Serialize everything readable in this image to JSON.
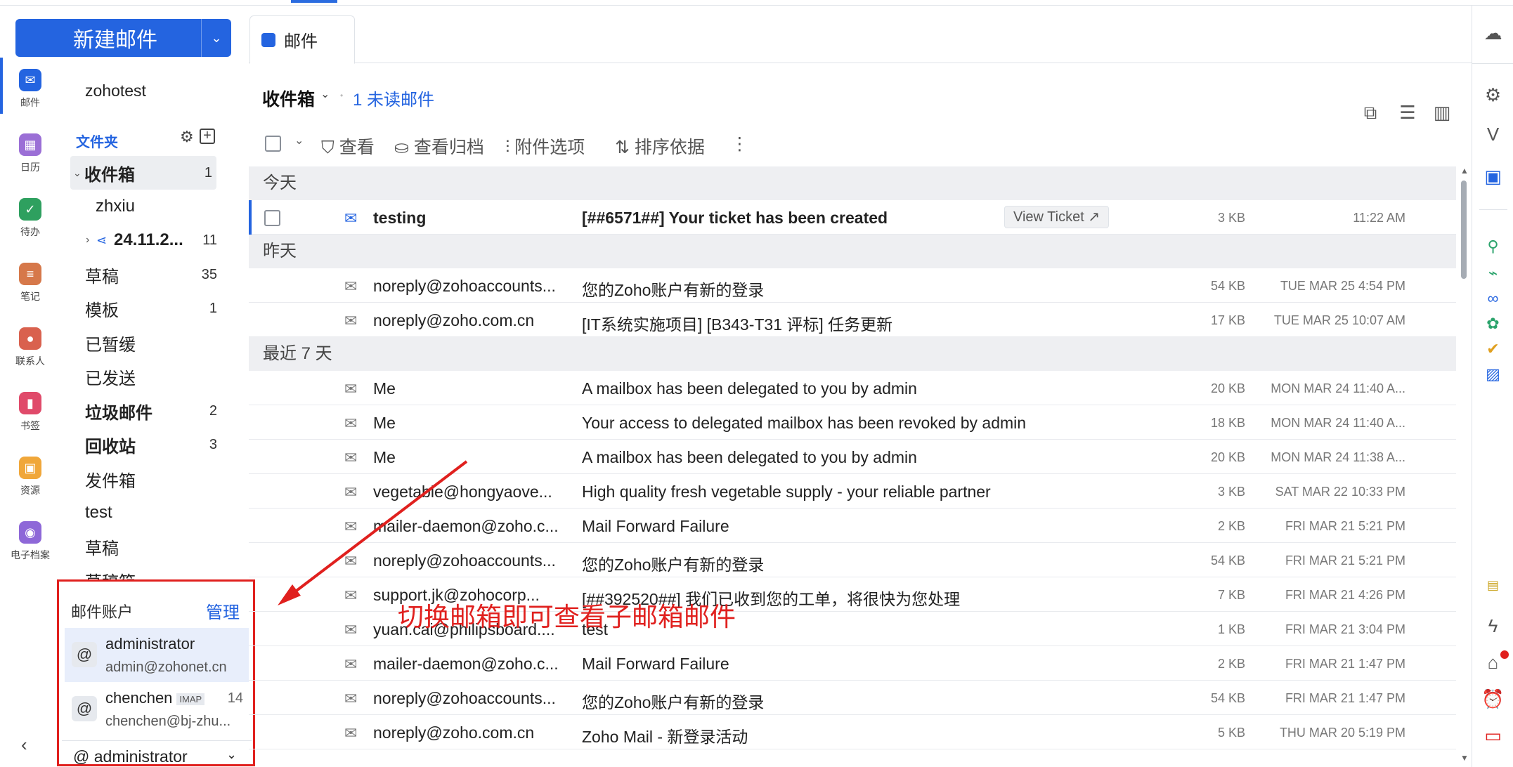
{
  "new_mail": {
    "label": "新建邮件"
  },
  "rail": [
    {
      "label": "邮件",
      "icon": "mail-icon",
      "color": "#2464e0"
    },
    {
      "label": "日历",
      "icon": "calendar-icon",
      "color": "#9b6fd6"
    },
    {
      "label": "待办",
      "icon": "check-icon",
      "color": "#2ea05f"
    },
    {
      "label": "笔记",
      "icon": "note-icon",
      "color": "#d6784a"
    },
    {
      "label": "联系人",
      "icon": "contact-icon",
      "color": "#d9614e"
    },
    {
      "label": "书签",
      "icon": "bookmark-icon",
      "color": "#e04a6a"
    },
    {
      "label": "资源",
      "icon": "resource-icon",
      "color": "#f0a73a"
    },
    {
      "label": "电子档案",
      "icon": "archive-icon",
      "color": "#8e68d8"
    }
  ],
  "folder_pane": {
    "account": "zohotest",
    "folders_label": "文件夹",
    "folders": [
      {
        "name": "收件箱",
        "count": "1"
      },
      {
        "name": "zhxiu",
        "count": ""
      },
      {
        "name": "24.11.2...",
        "count": "11"
      },
      {
        "name": "草稿",
        "count": "35"
      },
      {
        "name": "模板",
        "count": "1"
      },
      {
        "name": "已暂缓",
        "count": ""
      },
      {
        "name": "已发送",
        "count": ""
      },
      {
        "name": "垃圾邮件",
        "count": "2"
      },
      {
        "name": "回收站",
        "count": "3"
      },
      {
        "name": "发件箱",
        "count": ""
      },
      {
        "name": "test",
        "count": ""
      },
      {
        "name": "草稿",
        "count": ""
      },
      {
        "name": "草稿箱",
        "count": ""
      }
    ]
  },
  "accounts": {
    "title": "邮件账户",
    "manage": "管理",
    "items": [
      {
        "name": "administrator",
        "email": "admin@zohonet.cn",
        "tag": "",
        "count": ""
      },
      {
        "name": "chenchen",
        "email": "chenchen@bj-zhu...",
        "tag": "IMAP",
        "count": "14"
      }
    ],
    "selected": "administrator"
  },
  "tab": {
    "label": "邮件"
  },
  "mail_header": {
    "folder": "收件箱",
    "unread": "1 未读邮件"
  },
  "toolbar": {
    "view": "查看",
    "archive": "查看归档",
    "attachments": "附件选项",
    "sort": "排序依据"
  },
  "groups": {
    "today": "今天",
    "yesterday": "昨天",
    "last7": "最近 7 天"
  },
  "messages": [
    {
      "sender": "testing",
      "subject": "[##6571##] Your ticket has been created",
      "tag": "View Ticket",
      "size": "3 KB",
      "date": "11:22 AM"
    },
    {
      "sender": "noreply@zohoaccounts...",
      "subject": "您的Zoho账户有新的登录",
      "size": "54 KB",
      "date": "TUE MAR 25 4:54 PM"
    },
    {
      "sender": "noreply@zoho.com.cn",
      "subject": "[IT系统实施项目] [B343-T31 评标] 任务更新",
      "size": "17 KB",
      "date": "TUE MAR 25 10:07 AM"
    },
    {
      "sender": "Me",
      "subject": "A mailbox has been delegated to you by admin",
      "size": "20 KB",
      "date": "MON MAR 24 11:40 A..."
    },
    {
      "sender": "Me",
      "subject": "Your access to delegated mailbox has been revoked by admin",
      "size": "18 KB",
      "date": "MON MAR 24 11:40 A..."
    },
    {
      "sender": "Me",
      "subject": "A mailbox has been delegated to you by admin",
      "size": "20 KB",
      "date": "MON MAR 24 11:38 A..."
    },
    {
      "sender": "vegetable@hongyaove...",
      "subject": "High quality fresh vegetable supply - your reliable partner",
      "size": "3 KB",
      "date": "SAT MAR 22 10:33 PM"
    },
    {
      "sender": "mailer-daemon@zoho.c...",
      "subject": "Mail Forward Failure",
      "size": "2 KB",
      "date": "FRI MAR 21 5:21 PM"
    },
    {
      "sender": "noreply@zohoaccounts...",
      "subject": "您的Zoho账户有新的登录",
      "size": "54 KB",
      "date": "FRI MAR 21 5:21 PM"
    },
    {
      "sender": "support.jk@zohocorp...",
      "subject": "[##392520##] 我们已收到您的工单，将很快为您处理",
      "size": "7 KB",
      "date": "FRI MAR 21 4:26 PM"
    },
    {
      "sender": "yuan.cai@philipsboard....",
      "subject": "test",
      "size": "1 KB",
      "date": "FRI MAR 21 3:04 PM"
    },
    {
      "sender": "mailer-daemon@zoho.c...",
      "subject": "Mail Forward Failure",
      "size": "2 KB",
      "date": "FRI MAR 21 1:47 PM"
    },
    {
      "sender": "noreply@zohoaccounts...",
      "subject": "您的Zoho账户有新的登录",
      "size": "54 KB",
      "date": "FRI MAR 21 1:47 PM"
    },
    {
      "sender": "noreply@zoho.com.cn",
      "subject": "Zoho Mail - 新登录活动",
      "size": "5 KB",
      "date": "THU MAR 20 5:19 PM"
    }
  ],
  "annotation": "切换邮箱即可查看子邮箱邮件",
  "colors": {
    "accent": "#2464e0",
    "annotation": "#e0201e"
  }
}
